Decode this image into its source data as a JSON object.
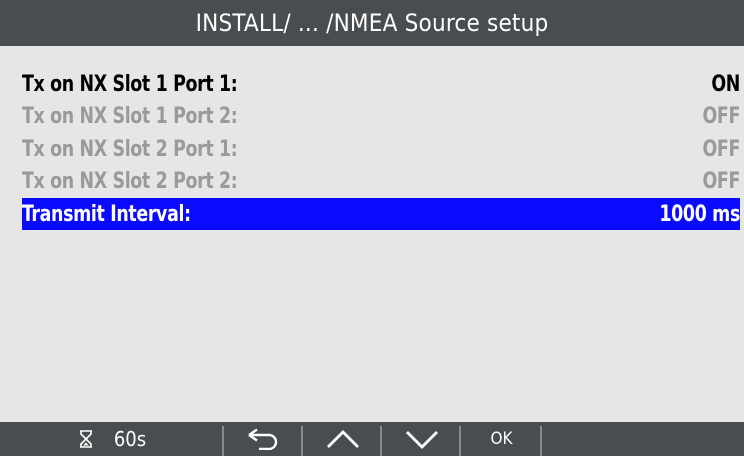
{
  "header": {
    "title": "INSTALL/ ... /NMEA Source setup"
  },
  "settings": [
    {
      "label": "Tx on NX Slot 1 Port 1:",
      "value": "ON"
    },
    {
      "label": "Tx on NX Slot 1 Port 2:",
      "value": "OFF"
    },
    {
      "label": "Tx on NX Slot 2 Port 1:",
      "value": "OFF"
    },
    {
      "label": "Tx on NX Slot 2 Port 2:",
      "value": "OFF"
    },
    {
      "label": "Transmit Interval:",
      "value": "1000 ms"
    }
  ],
  "footer": {
    "timer_icon": "hourglass-icon",
    "timer_label": "60s",
    "back_icon": "return-arrow-icon",
    "up_icon": "chevron-up-icon",
    "down_icon": "chevron-down-icon",
    "ok_label": "OK"
  },
  "colors": {
    "header_bg": "#4a4d4f",
    "screen_bg": "#e6e6e6",
    "selection": "#0a0aff",
    "active_text": "#000000",
    "dimmed_text": "#9a9a9a"
  }
}
